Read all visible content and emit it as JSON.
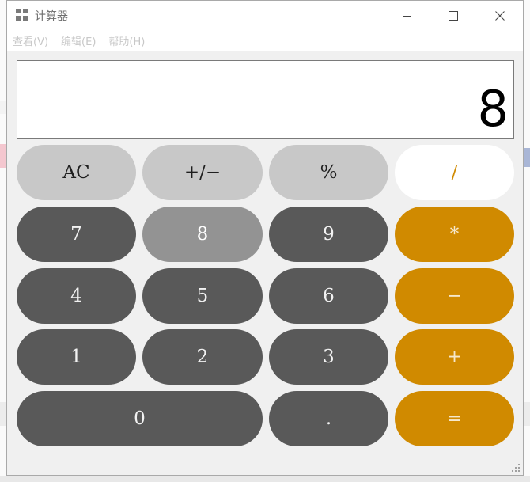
{
  "window": {
    "title": "计算器",
    "icon": "calculator-grid-icon",
    "controls": [
      "minimize-icon",
      "maximize-icon",
      "close-icon"
    ]
  },
  "menu": {
    "items": [
      {
        "label": "查看(V)"
      },
      {
        "label": "编辑(E)"
      },
      {
        "label": "帮助(H)"
      }
    ]
  },
  "display": {
    "value": "8"
  },
  "keypad": {
    "rows": [
      [
        {
          "label": "AC",
          "style": "light"
        },
        {
          "label": "+/−",
          "style": "light"
        },
        {
          "label": "%",
          "style": "light"
        },
        {
          "label": "/",
          "style": "operator-active"
        }
      ],
      [
        {
          "label": "7",
          "style": "dark"
        },
        {
          "label": "8",
          "style": "pressed"
        },
        {
          "label": "9",
          "style": "dark"
        },
        {
          "label": "*",
          "style": "operator"
        }
      ],
      [
        {
          "label": "4",
          "style": "dark"
        },
        {
          "label": "5",
          "style": "dark"
        },
        {
          "label": "6",
          "style": "dark"
        },
        {
          "label": "−",
          "style": "operator"
        }
      ],
      [
        {
          "label": "1",
          "style": "dark"
        },
        {
          "label": "2",
          "style": "dark"
        },
        {
          "label": "3",
          "style": "dark"
        },
        {
          "label": "+",
          "style": "operator"
        }
      ],
      [
        {
          "label": "0",
          "style": "dark"
        },
        {
          "label": ".",
          "style": "dark"
        },
        {
          "label": "=",
          "style": "operator"
        }
      ]
    ]
  },
  "colors": {
    "accent": "#d08a00",
    "dark_key": "#595959",
    "light_key": "#c8c8c8",
    "pressed_key": "#939393"
  }
}
